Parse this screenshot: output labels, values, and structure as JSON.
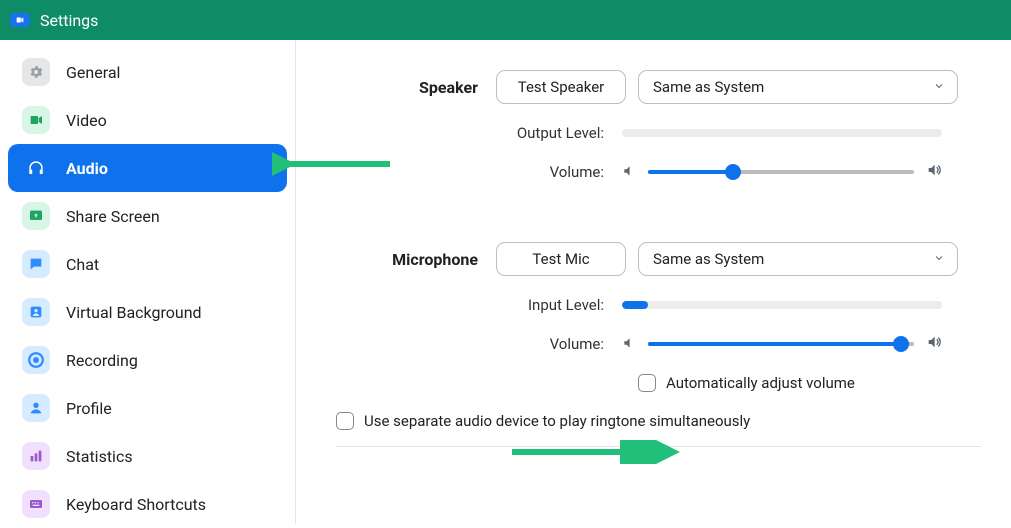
{
  "window": {
    "title": "Settings"
  },
  "sidebar": {
    "items": [
      {
        "label": "General"
      },
      {
        "label": "Video"
      },
      {
        "label": "Audio"
      },
      {
        "label": "Share Screen"
      },
      {
        "label": "Chat"
      },
      {
        "label": "Virtual Background"
      },
      {
        "label": "Recording"
      },
      {
        "label": "Profile"
      },
      {
        "label": "Statistics"
      },
      {
        "label": "Keyboard Shortcuts"
      }
    ]
  },
  "audio": {
    "speaker": {
      "heading": "Speaker",
      "test_button": "Test Speaker",
      "device_selected": "Same as System",
      "output_level_label": "Output Level:",
      "output_level_percent": 0,
      "volume_label": "Volume:",
      "volume_percent": 32
    },
    "mic": {
      "heading": "Microphone",
      "test_button": "Test Mic",
      "device_selected": "Same as System",
      "input_level_label": "Input Level:",
      "input_level_percent": 8,
      "volume_label": "Volume:",
      "volume_percent": 95,
      "auto_adjust_label": "Automatically adjust volume",
      "auto_adjust_checked": false
    },
    "separate_ringtone_label": "Use separate audio device to play ringtone simultaneously",
    "separate_ringtone_checked": false
  }
}
